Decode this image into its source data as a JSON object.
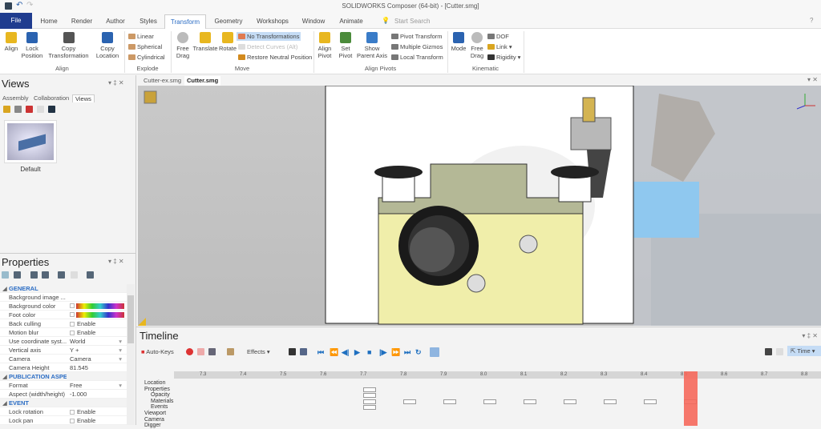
{
  "title": "SOLIDWORKS Composer (64-bit) - [Cutter.smg]",
  "ribbon_tabs": [
    "File",
    "Home",
    "Render",
    "Author",
    "Styles",
    "Transform",
    "Geometry",
    "Workshops",
    "Window",
    "Animate"
  ],
  "search_placeholder": "Start Search",
  "ribbon": {
    "align": {
      "label": "Align",
      "buttons": [
        "Align",
        "Lock Position",
        "Copy Transformation",
        "Copy Location"
      ]
    },
    "explode": {
      "label": "Explode",
      "items": [
        "Linear",
        "Spherical",
        "Cylindrical"
      ]
    },
    "move": {
      "label": "Move",
      "buttons": [
        "Free Drag",
        "Translate",
        "Rotate"
      ],
      "items": [
        "No Transformations",
        "Detect Curves (Alt)",
        "Restore Neutral Position"
      ]
    },
    "align_pivots": {
      "label": "Align Pivots",
      "buttons": [
        "Align Pivot",
        "Set Pivot",
        "Show Parent Axis"
      ],
      "items": [
        "Pivot Transform",
        "Multiple Gizmos",
        "Local Transform"
      ]
    },
    "kinematic": {
      "label": "Kinematic",
      "buttons": [
        "Mode",
        "Free Drag"
      ],
      "items": [
        "DOF",
        "Link",
        "Rigidity"
      ]
    }
  },
  "views_panel": {
    "title": "Views",
    "tabs": [
      "Assembly",
      "Collaboration",
      "Views"
    ],
    "active_tab": "Views",
    "thumbnail_label": "Default"
  },
  "properties": {
    "title": "Properties",
    "rows": [
      {
        "type": "section",
        "key": "GENERAL"
      },
      {
        "key": "Background image ...",
        "value": ""
      },
      {
        "key": "Background color",
        "value": "",
        "color": true
      },
      {
        "key": "Foot color",
        "value": "",
        "color": true
      },
      {
        "key": "Back culling",
        "value": "Enable",
        "check": true
      },
      {
        "key": "Motion blur",
        "value": "Enable",
        "check": true
      },
      {
        "key": "Use coordinate syst...",
        "value": "World",
        "dropdown": true
      },
      {
        "key": "Vertical axis",
        "value": "Y +",
        "dropdown": true
      },
      {
        "key": "Camera",
        "value": "Camera",
        "dropdown": true
      },
      {
        "key": "Camera Height",
        "value": "81.545"
      },
      {
        "type": "section",
        "key": "PUBLICATION ASPECT"
      },
      {
        "key": "Format",
        "value": "Free",
        "dropdown": true
      },
      {
        "key": "Aspect (width/height)",
        "value": "-1.000"
      },
      {
        "type": "section",
        "key": "EVENT"
      },
      {
        "key": "Lock rotation",
        "value": "Enable",
        "check": true
      },
      {
        "key": "Lock pan",
        "value": "Enable",
        "check": true
      }
    ]
  },
  "doc_tabs": [
    "Cutter-ex.smg",
    "Cutter.smg"
  ],
  "active_doc": "Cutter.smg",
  "timeline": {
    "title": "Timeline",
    "auto_keys": "Auto-Keys",
    "effects": "Effects",
    "mode": "Time",
    "ticks": [
      "7.3",
      "7.4",
      "7.5",
      "7.6",
      "7.7",
      "7.8",
      "7.9",
      "8.0",
      "8.1",
      "8.2",
      "8.3",
      "8.4",
      "8.5",
      "8.6",
      "8.7",
      "8.8"
    ],
    "current_time": 8.5,
    "tracks": [
      "Location",
      "Properties",
      "Opacity",
      "Materials",
      "Events",
      "Viewport",
      "Camera",
      "Digger"
    ],
    "keyframes_materials": [
      7.7,
      7.8,
      7.9,
      8.0,
      8.1,
      8.2,
      8.3,
      8.4,
      8.5
    ],
    "keyframes_stack_time": 7.7
  },
  "colors": {
    "accent": "#2a6cc4",
    "file_tab": "#1f3c8f",
    "playhead": "#f6695c",
    "highlight": "#c5dcf5"
  }
}
